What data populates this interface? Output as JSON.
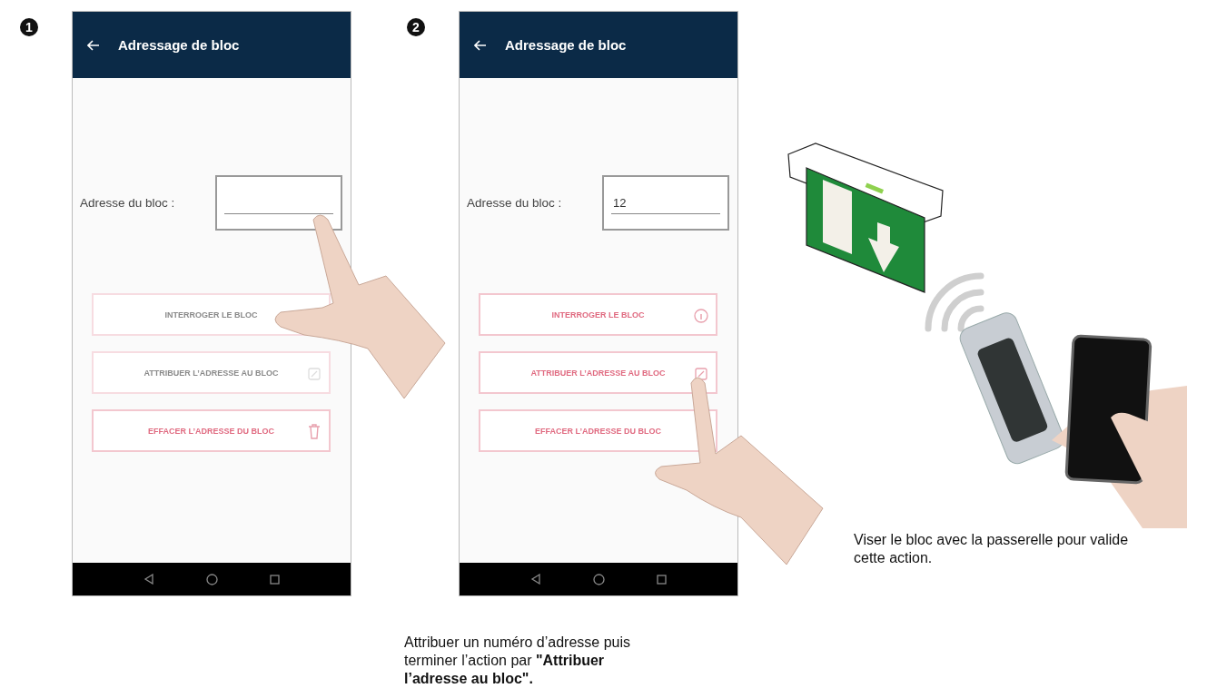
{
  "steps": [
    {
      "number": "1",
      "screen": {
        "title": "Adressage de bloc",
        "field": {
          "label": "Adresse du bloc :"
        },
        "buttons": [
          {
            "label": "INTERROGER LE BLOC",
            "disabled": true
          },
          {
            "label": "ATTRIBUER L’ADRESSE AU BLOC",
            "kind": "assign",
            "disabled": true
          },
          {
            "label": "EFFACER L’ADRESSE DU BLOC",
            "kind": "erase",
            "disabled": false
          }
        ]
      }
    },
    {
      "number": "2",
      "screen": {
        "title": "Adressage de bloc",
        "field": {
          "label": "Adresse du bloc :",
          "value": "12"
        },
        "buttons": [
          {
            "label": "INTERROGER LE BLOC",
            "kind": "info",
            "disabled": false
          },
          {
            "label": "ATTRIBUER L’ADRESSE AU BLOC",
            "kind": "assign",
            "disabled": false
          },
          {
            "label": "EFFACER L’ADRESSE DU BLOC",
            "disabled": false
          }
        ]
      },
      "caption": "Attribuer un numéro d’adresse puis terminer l’action par **\"Attribuer l’adresse au bloc\".**"
    }
  ],
  "illustration": {
    "caption": "Viser le bloc avec la passerelle pour valide\ncette action."
  }
}
